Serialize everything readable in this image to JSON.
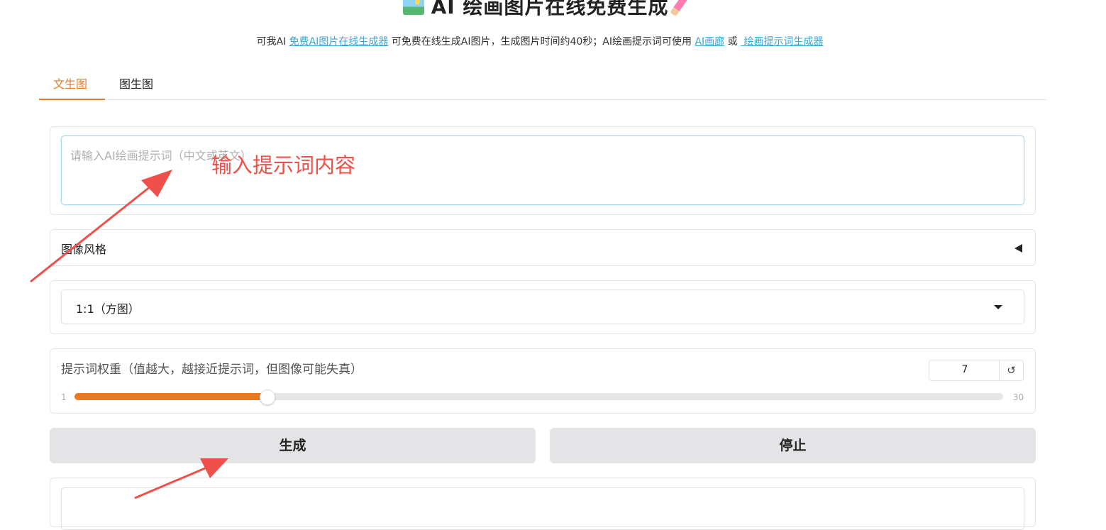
{
  "header": {
    "title": "AI 绘画图片在线免费生成",
    "emoji_left": "picture-icon",
    "emoji_right": "crayon-icon"
  },
  "subtitle": {
    "prefix": "可我AI ",
    "link1": "免费AI图片在线生成器",
    "middle": " 可免费在线生成AI图片，生成图片时间约40秒；AI绘画提示词可使用 ",
    "link2": "AI画廊",
    "sep": " 或 ",
    "link3": " 绘画提示词生成器"
  },
  "tabs": [
    {
      "label": "文生图",
      "active": true
    },
    {
      "label": "图生图",
      "active": false
    }
  ],
  "prompt": {
    "placeholder": "请输入AI绘画提示词（中文或英文）",
    "value": ""
  },
  "style_section": {
    "label": "图像风格",
    "collapsed_icon": "caret-left-icon"
  },
  "ratio_select": {
    "value": "1:1（方图）"
  },
  "weight": {
    "label": "提示词权重（值越大，越接近提示词，但图像可能失真）",
    "value": "7",
    "min": "1",
    "max": "30",
    "reset_icon": "↺"
  },
  "buttons": {
    "generate": "生成",
    "stop": "停止"
  },
  "annotation": {
    "text": "输入提示词内容",
    "color": "#f0504a"
  },
  "colors": {
    "accent": "#e87a2a",
    "slider_fill": "#f07818",
    "link": "#3aa6d6"
  }
}
